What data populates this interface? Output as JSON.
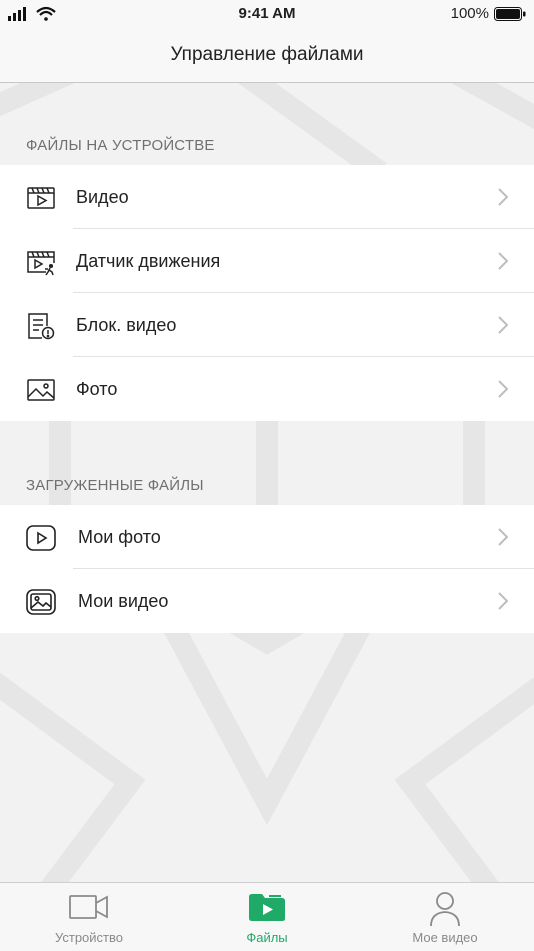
{
  "status_bar": {
    "time": "9:41 AM",
    "battery": "100%"
  },
  "header": {
    "title": "Управление файлами"
  },
  "sections": [
    {
      "title": "ФАЙЛЫ НА УСТРОЙСТВЕ",
      "items": [
        {
          "label": "Видео",
          "icon": "video-clip-icon"
        },
        {
          "label": "Датчик движения",
          "icon": "motion-video-icon"
        },
        {
          "label": "Блок. видео",
          "icon": "locked-video-icon"
        },
        {
          "label": "Фото",
          "icon": "photo-icon"
        }
      ]
    },
    {
      "title": "ЗАГРУЖЕННЫЕ ФАЙЛЫ",
      "items": [
        {
          "label": "Мои фото",
          "icon": "play-circle-icon"
        },
        {
          "label": "Мои видео",
          "icon": "image-icon"
        }
      ]
    }
  ],
  "tab_bar": {
    "tabs": [
      {
        "label": "Устройство",
        "icon": "camera-icon",
        "active": false
      },
      {
        "label": "Файлы",
        "icon": "folder-play-icon",
        "active": true
      },
      {
        "label": "Мое видео",
        "icon": "person-icon",
        "active": false
      }
    ]
  },
  "colors": {
    "accent": "#1faa68",
    "background": "#f2f2f2",
    "text": "#222222",
    "secondary": "#707070"
  }
}
